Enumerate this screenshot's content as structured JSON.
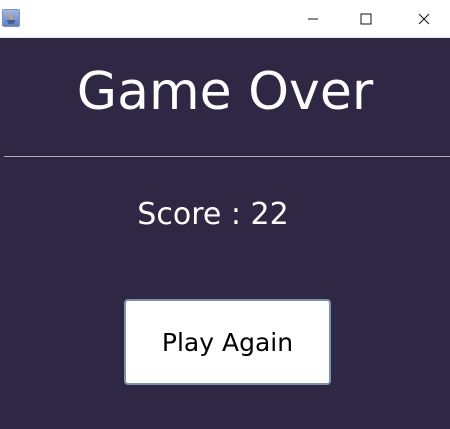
{
  "titlebar": {
    "icons": {
      "app": "java-app-icon",
      "minimize": "minimize-icon",
      "maximize": "maximize-icon",
      "close": "close-icon"
    }
  },
  "game": {
    "title": "Game Over",
    "score_text": "Score : 22",
    "play_again_label": "Play Again"
  },
  "colors": {
    "background": "#2f2844",
    "text": "#ffffff",
    "button_bg": "#ffffff",
    "button_border": "#7a91b2"
  }
}
